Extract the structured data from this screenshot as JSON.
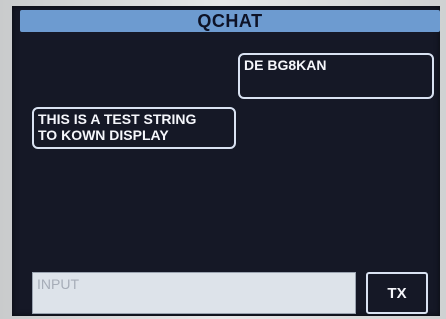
{
  "app": {
    "title": "QCHAT"
  },
  "messages": [
    {
      "side": "right",
      "text": "DE BG8KAN"
    },
    {
      "side": "left",
      "text": "THIS IS A TEST STRING\nTO KOWN DISPLAY"
    }
  ],
  "input": {
    "placeholder": "INPUT",
    "value": ""
  },
  "actions": {
    "tx_label": "TX"
  },
  "colors": {
    "screen_bg": "#151826",
    "title_bar": "#6d9bd0",
    "bubble_border": "#d9e2f2",
    "text": "#f5f6fb",
    "input_bg": "#dde3ea"
  }
}
